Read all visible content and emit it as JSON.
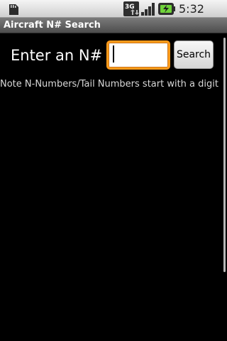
{
  "status_bar": {
    "time": "5:32 AM",
    "network_label": "3G",
    "icons": [
      "sd-card-icon",
      "3g-data-icon",
      "signal-strength-icon",
      "battery-charging-icon"
    ]
  },
  "app": {
    "title": "Aircraft N# Search"
  },
  "search": {
    "prompt_label": "Enter an N#",
    "input_value": "",
    "button_label": "Search",
    "note": "Note N-Numbers/Tail Numbers start with a digit"
  },
  "colors": {
    "background": "#000000",
    "focus_border": "#ff9a1a",
    "title_bar": "#5e5e5e"
  }
}
